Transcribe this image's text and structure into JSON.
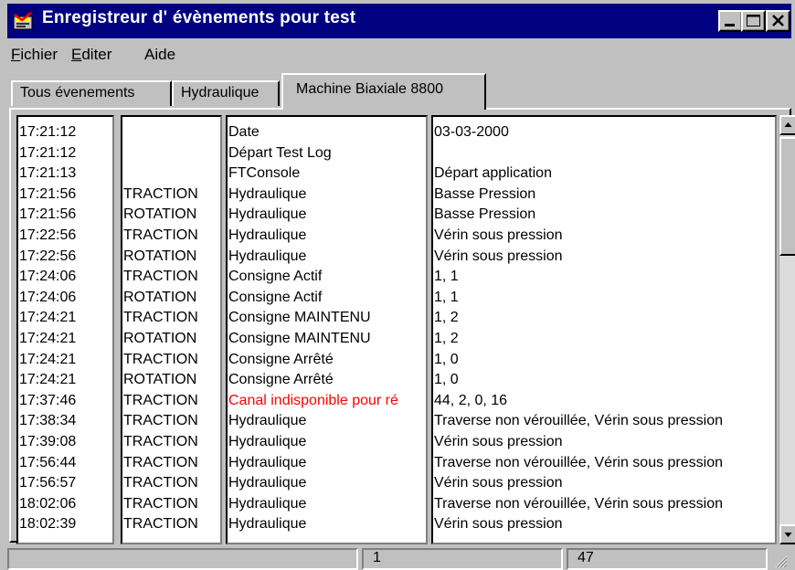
{
  "window": {
    "title": "Enregistreur d' évènements pour test",
    "title_bar_color": "#000080"
  },
  "menu": {
    "file": {
      "accel": "F",
      "rest": "ichier"
    },
    "edit": {
      "accel": "E",
      "rest": "diter"
    },
    "help": {
      "accel": "",
      "rest": "Aide"
    }
  },
  "tabs": [
    {
      "label": "Tous évenements"
    },
    {
      "label": "Hydraulique"
    },
    {
      "label": "Machine Biaxiale 8800",
      "active": true
    }
  ],
  "log": {
    "rows": [
      {
        "time": "17:21:12",
        "subsystem": "",
        "category": "Date",
        "detail": "03-03-2000"
      },
      {
        "time": "17:21:12",
        "subsystem": "",
        "category": "Départ Test Log",
        "detail": ""
      },
      {
        "time": "17:21:13",
        "subsystem": "",
        "category": "FTConsole",
        "detail": "Départ application"
      },
      {
        "time": "17:21:56",
        "subsystem": "TRACTION",
        "category": "Hydraulique",
        "detail": "Basse Pression"
      },
      {
        "time": "17:21:56",
        "subsystem": "ROTATION",
        "category": "Hydraulique",
        "detail": "Basse Pression"
      },
      {
        "time": "17:22:56",
        "subsystem": "TRACTION",
        "category": "Hydraulique",
        "detail": "Vérin sous pression"
      },
      {
        "time": "17:22:56",
        "subsystem": "ROTATION",
        "category": "Hydraulique",
        "detail": "Vérin sous pression"
      },
      {
        "time": "17:24:06",
        "subsystem": "TRACTION",
        "category": "Consigne Actif",
        "detail": " 1, 1"
      },
      {
        "time": "17:24:06",
        "subsystem": "ROTATION",
        "category": "Consigne Actif",
        "detail": " 1, 1"
      },
      {
        "time": "17:24:21",
        "subsystem": "TRACTION",
        "category": "Consigne MAINTENU",
        "detail": " 1, 2"
      },
      {
        "time": "17:24:21",
        "subsystem": "ROTATION",
        "category": "Consigne MAINTENU",
        "detail": " 1, 2"
      },
      {
        "time": "17:24:21",
        "subsystem": "TRACTION",
        "category": "Consigne Arrêté",
        "detail": " 1, 0"
      },
      {
        "time": "17:24:21",
        "subsystem": "ROTATION",
        "category": "Consigne Arrêté",
        "detail": " 1, 0"
      },
      {
        "time": "17:37:46",
        "subsystem": "TRACTION",
        "category": "Canal indisponible pour ré",
        "detail": " 44, 2, 0, 16",
        "error": true
      },
      {
        "time": "17:38:34",
        "subsystem": "TRACTION",
        "category": "Hydraulique",
        "detail": "Traverse non vérouillée, Vérin sous pression"
      },
      {
        "time": "17:39:08",
        "subsystem": "TRACTION",
        "category": "Hydraulique",
        "detail": "Vérin sous pression"
      },
      {
        "time": "17:56:44",
        "subsystem": "TRACTION",
        "category": "Hydraulique",
        "detail": "Traverse non vérouillée, Vérin sous pression"
      },
      {
        "time": "17:56:57",
        "subsystem": "TRACTION",
        "category": "Hydraulique",
        "detail": "Vérin sous pression"
      },
      {
        "time": "18:02:06",
        "subsystem": "TRACTION",
        "category": "Hydraulique",
        "detail": "Traverse non vérouillée, Vérin sous pression"
      },
      {
        "time": "18:02:39",
        "subsystem": "TRACTION",
        "category": "Hydraulique",
        "detail": "Vérin sous pression"
      }
    ],
    "error_color": "#ff0000"
  },
  "status": {
    "panel1": "",
    "panel2": "1",
    "panel3": "47"
  }
}
